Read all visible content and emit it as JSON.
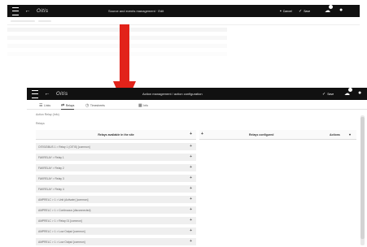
{
  "top_app": {
    "logo": "Oitis",
    "title": "Source and events management · Edit",
    "cancel_label": "Cancel",
    "save_label": "Save"
  },
  "app": {
    "logo": "Oitis",
    "title": "Action management / action configuration",
    "save_label": "Save",
    "tabs": [
      {
        "label": "Links",
        "icon": "list-icon"
      },
      {
        "label": "Relays",
        "icon": "relay-icon"
      },
      {
        "label": "Timesheets",
        "icon": "clock-icon"
      },
      {
        "label": "Info",
        "icon": "info-icon"
      }
    ],
    "breadcrumb": "Action Relay (Info)",
    "section_label": "Relays",
    "available": {
      "header": "Relays available in the site",
      "rows": [
        "OITIS/DBUS 1 > Relay 1 (OITIS) [common]",
        "FAKRELAY > Relay 1",
        "FAKRELAY > Relay 2",
        "FAKRELAY > Relay 3",
        "FAKRELAY > Relay 4",
        "AMPRELC > 1 > Unit (Activate) [common]",
        "AMPRELC > 1 > Continuous (disconnected)",
        "AMPRELC > 1 > Relay 01 [common]",
        "AMPRELC > 1 > Low Output [common]",
        "AMPRELC > 1 > Low Output [common]"
      ]
    },
    "configured": {
      "header": "Relays configured",
      "action_header": "Actions"
    }
  },
  "colors": {
    "bar": "#111111",
    "arrow": "#e2231a",
    "row_bg": "#efefef"
  }
}
